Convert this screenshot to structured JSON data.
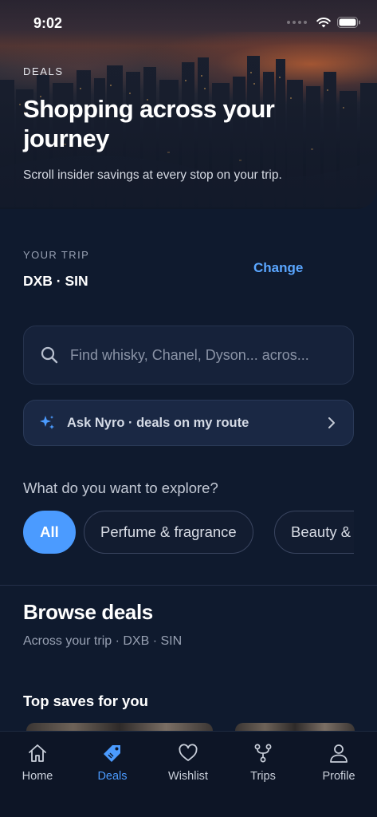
{
  "status_bar": {
    "time": "9:02"
  },
  "hero": {
    "tag": "DEALS",
    "title": "Shopping across your journey",
    "subtitle": "Scroll insider savings at every stop on your trip."
  },
  "trip": {
    "label": "YOUR TRIP",
    "route": "DXB · SIN",
    "change_label": "Change"
  },
  "search": {
    "placeholder": "Find whisky, Chanel, Dyson... acros..."
  },
  "ask": {
    "label": "Ask Nyro · deals on my route",
    "icon": "sparkle-icon"
  },
  "explore": {
    "question": "What do you want to explore?",
    "chips": [
      {
        "label": "All",
        "active": true
      },
      {
        "label": "Perfume & fragrance",
        "active": false
      },
      {
        "label": "Beauty &",
        "active": false
      }
    ]
  },
  "browse": {
    "title": "Browse deals",
    "subtitle": "Across your trip · DXB · SIN",
    "section_title": "Top saves for you"
  },
  "tabbar": {
    "items": [
      {
        "label": "Home",
        "icon": "home-icon",
        "active": false
      },
      {
        "label": "Deals",
        "icon": "tag-icon",
        "active": true
      },
      {
        "label": "Wishlist",
        "icon": "heart-icon",
        "active": false
      },
      {
        "label": "Trips",
        "icon": "route-icon",
        "active": false
      },
      {
        "label": "Profile",
        "icon": "person-icon",
        "active": false
      }
    ]
  },
  "colors": {
    "background": "#0f1a2e",
    "accent": "#4b9bff",
    "link": "#5aa6ff"
  }
}
